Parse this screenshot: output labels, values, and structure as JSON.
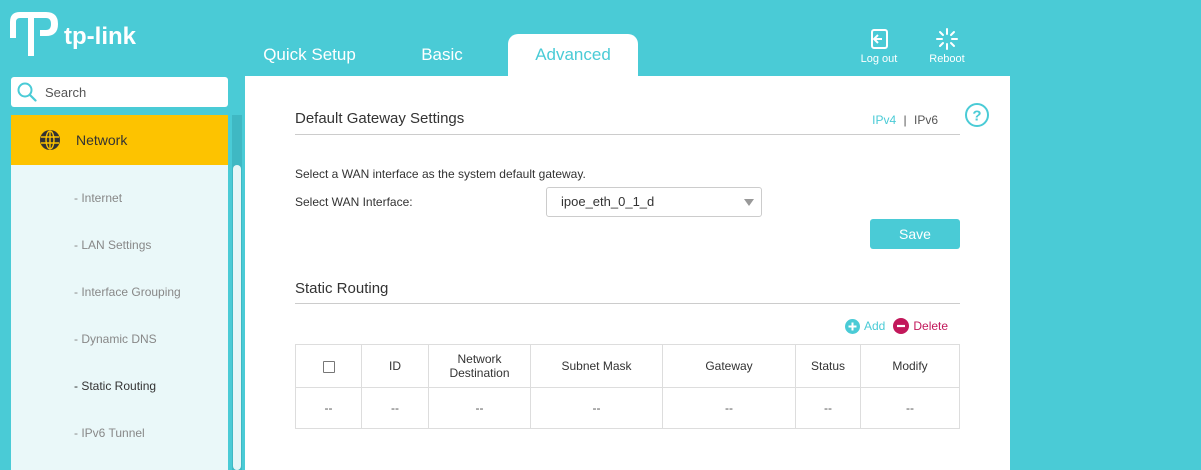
{
  "brand": {
    "logo_text": "tp-link"
  },
  "header": {
    "tabs": [
      {
        "label": "Quick Setup",
        "active": false
      },
      {
        "label": "Basic",
        "active": false
      },
      {
        "label": "Advanced",
        "active": true
      }
    ],
    "logout_label": "Log out",
    "reboot_label": "Reboot"
  },
  "sidebar": {
    "search_placeholder": "Search",
    "main_item": "Network",
    "items": [
      {
        "label": "- Internet"
      },
      {
        "label": "- LAN Settings"
      },
      {
        "label": "- Interface Grouping"
      },
      {
        "label": "- Dynamic DNS"
      },
      {
        "label": "- Static Routing",
        "active": true
      },
      {
        "label": "- IPv6 Tunnel"
      }
    ]
  },
  "gateway": {
    "title": "Default Gateway Settings",
    "ipv4": "IPv4",
    "separator": "|",
    "ipv6": "IPv6",
    "description": "Select a WAN interface as the system default gateway.",
    "wan_label": "Select WAN Interface:",
    "wan_value": "ipoe_eth_0_1_d",
    "save_label": "Save"
  },
  "routing": {
    "title": "Static Routing",
    "add_label": "Add",
    "delete_label": "Delete",
    "columns": {
      "id": "ID",
      "dest_line1": "Network",
      "dest_line2": "Destination",
      "mask": "Subnet Mask",
      "gateway": "Gateway",
      "status": "Status",
      "modify": "Modify"
    },
    "row": {
      "check": "--",
      "id": "--",
      "dest": "--",
      "mask": "--",
      "gateway": "--",
      "status": "--",
      "modify": "--"
    }
  },
  "colors": {
    "accent": "#4acbd6",
    "highlight": "#fdc300",
    "delete": "#c2185b"
  },
  "icons": [
    "tp-link-logo-icon",
    "logout-icon",
    "reboot-icon",
    "search-icon",
    "globe-icon",
    "help-icon",
    "add-icon",
    "delete-icon",
    "dropdown-caret-icon"
  ]
}
